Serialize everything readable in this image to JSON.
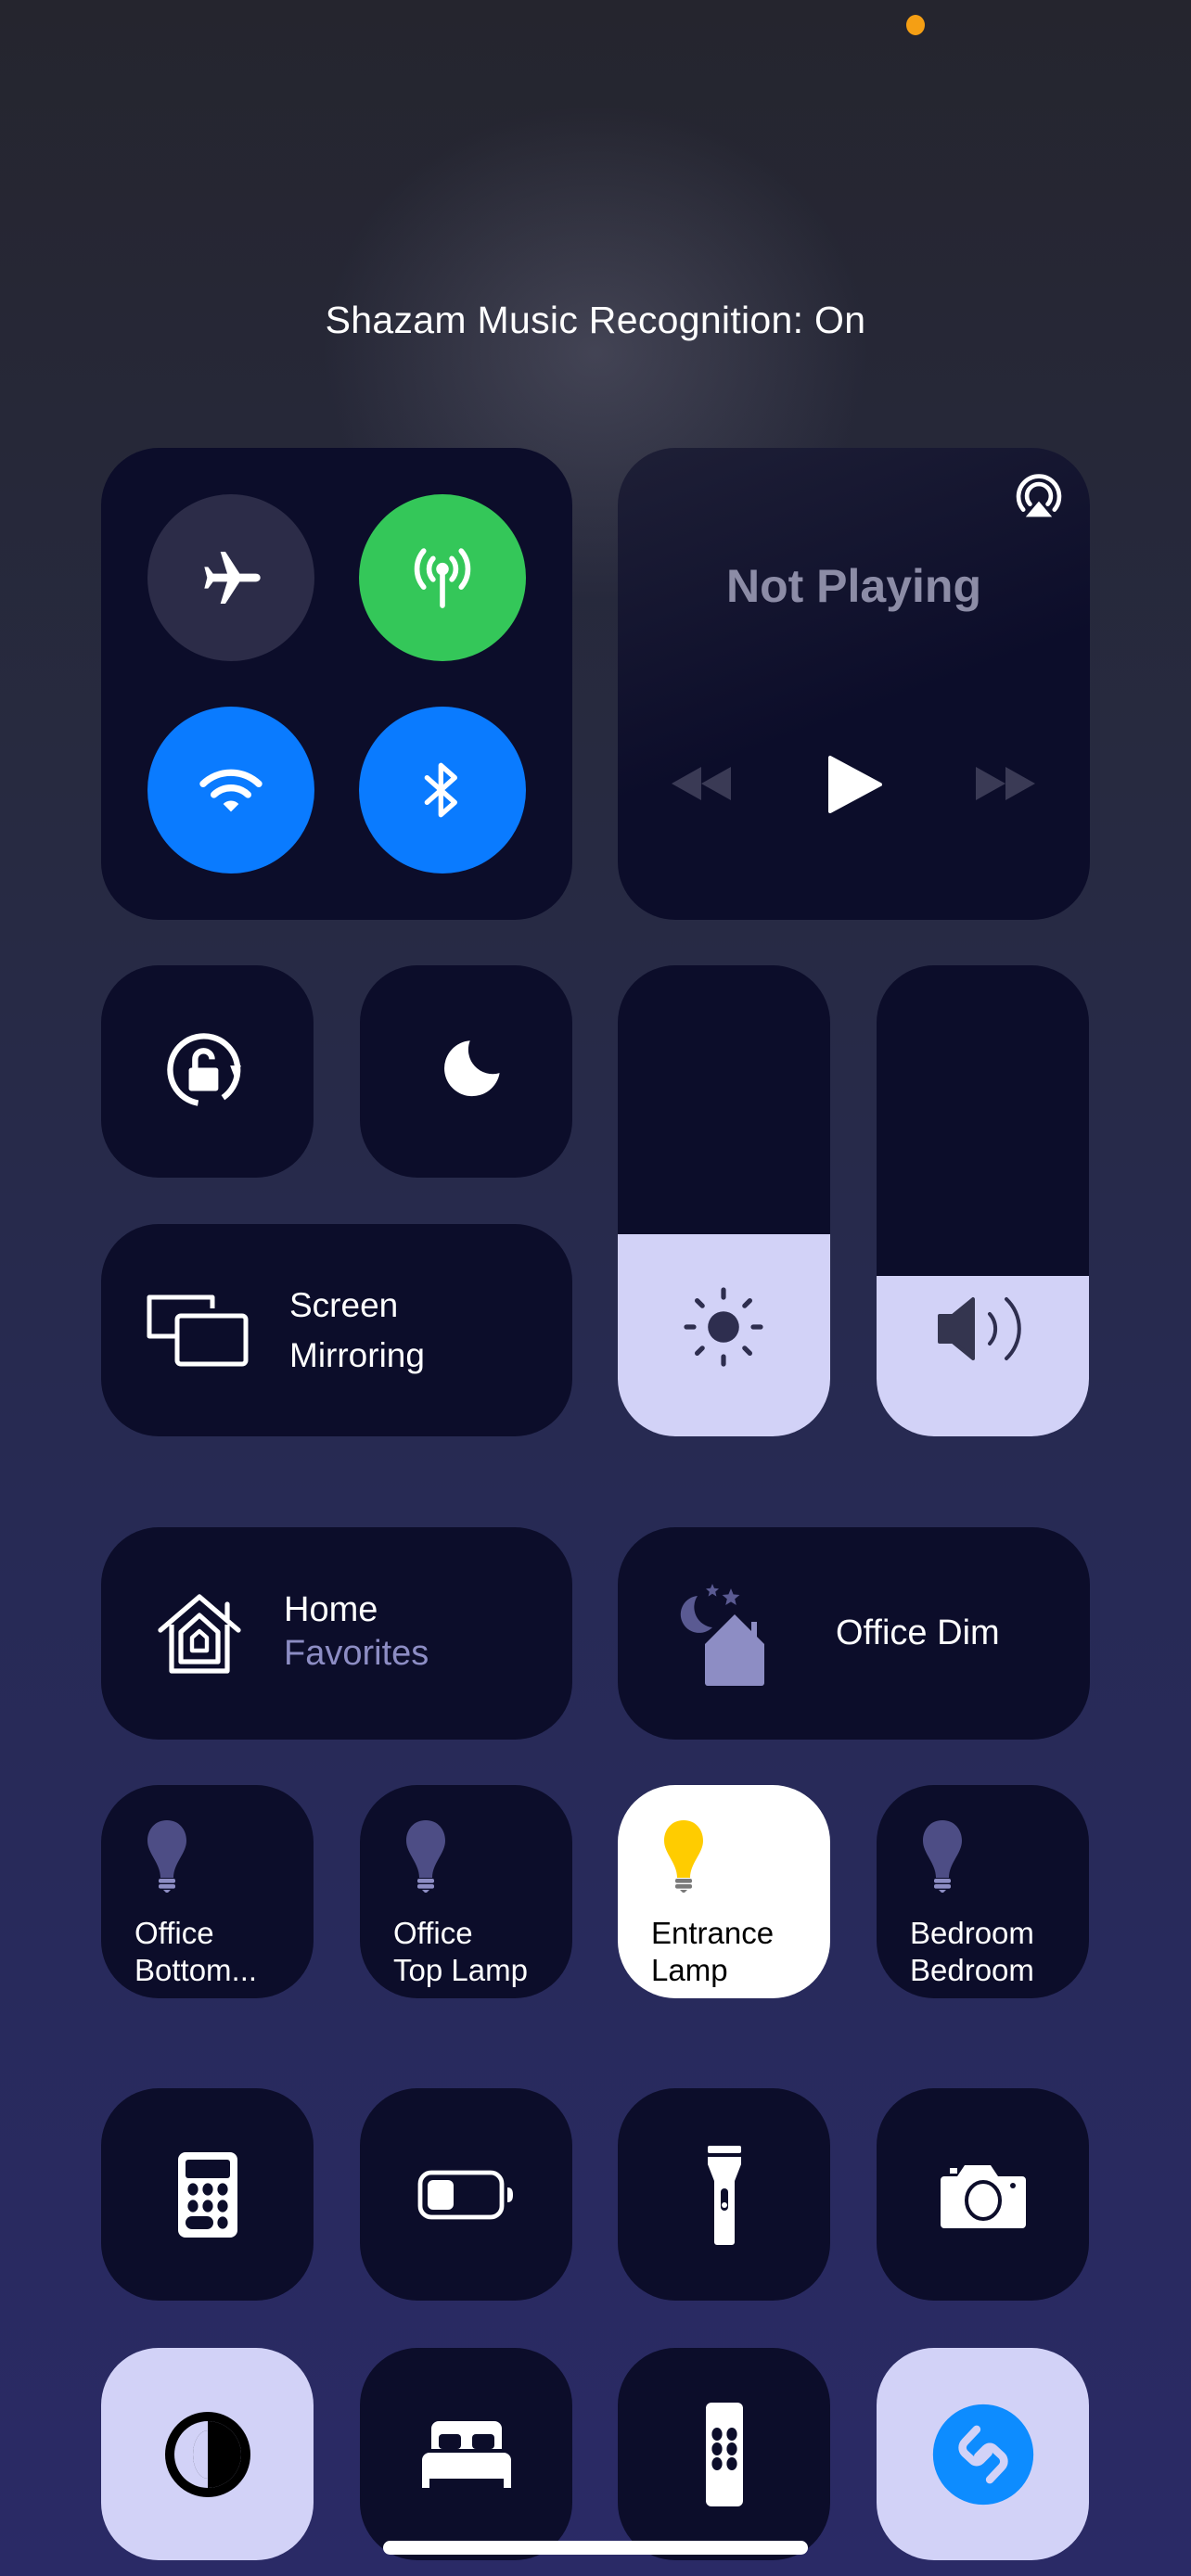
{
  "status": {
    "indicator": "microphone-in-use",
    "indicator_color": "#f59f14"
  },
  "banner": {
    "text": "Shazam Music Recognition: On"
  },
  "connectivity": {
    "airplane": {
      "label": "Airplane Mode",
      "state": "off",
      "color": "#2c2c48"
    },
    "cellular": {
      "label": "Cellular Data",
      "state": "on",
      "color": "#34c759"
    },
    "wifi": {
      "label": "Wi-Fi",
      "state": "on",
      "color": "#0a7bff"
    },
    "bluetooth": {
      "label": "Bluetooth",
      "state": "on",
      "color": "#0a7bff"
    }
  },
  "now_playing": {
    "title": "Not Playing",
    "airplay_label": "AirPlay"
  },
  "toggles": {
    "orientation_lock": {
      "label": "Orientation Lock",
      "state": "off"
    },
    "focus": {
      "label": "Do Not Disturb",
      "state": "off"
    }
  },
  "screen_mirroring": {
    "line1": "Screen",
    "line2": "Mirroring"
  },
  "sliders": {
    "brightness": {
      "label": "Brightness",
      "level_percent": 43
    },
    "volume": {
      "label": "Volume",
      "level_percent": 34
    }
  },
  "home": {
    "title": "Home",
    "subtitle": "Favorites"
  },
  "scene": {
    "label": "Office Dim"
  },
  "accessories": [
    {
      "line1": "Office",
      "line2": "Bottom...",
      "state": "off"
    },
    {
      "line1": "Office",
      "line2": "Top Lamp",
      "state": "off"
    },
    {
      "line1": "Entrance",
      "line2": "Lamp",
      "state": "on"
    },
    {
      "line1": "Bedroom",
      "line2": "Bedroom",
      "state": "off"
    }
  ],
  "utilities": [
    {
      "name": "Calculator"
    },
    {
      "name": "Low Power Mode"
    },
    {
      "name": "Flashlight"
    },
    {
      "name": "Camera"
    }
  ],
  "bottom_row": [
    {
      "name": "Dark Mode",
      "state": "on"
    },
    {
      "name": "Sleep",
      "state": "off"
    },
    {
      "name": "Apple TV Remote",
      "state": "off"
    },
    {
      "name": "Shazam",
      "state": "on"
    }
  ]
}
